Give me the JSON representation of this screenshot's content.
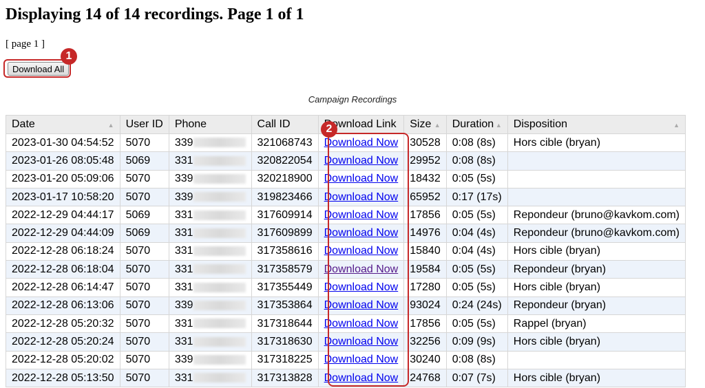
{
  "header": {
    "title": "Displaying 14 of 14 recordings. Page 1 of 1"
  },
  "pager": {
    "label": "[ page 1 ]"
  },
  "toolbar": {
    "download_all_label": "Download All"
  },
  "annotations": {
    "badge1": "1",
    "badge2": "2",
    "accent_color": "#c62828"
  },
  "table": {
    "caption": "Campaign Recordings",
    "columns": [
      "Date",
      "User ID",
      "Phone",
      "Call ID",
      "Download Link",
      "Size",
      "Duration",
      "Disposition"
    ],
    "rows": [
      {
        "date": "2023-01-30 04:54:52",
        "user_id": "5070",
        "phone": "339",
        "call_id": "321068743",
        "link": "Download Now",
        "size": "30528",
        "duration": "0:08 (8s)",
        "disposition": "Hors cible (bryan)"
      },
      {
        "date": "2023-01-26 08:05:48",
        "user_id": "5069",
        "phone": "331",
        "call_id": "320822054",
        "link": "Download Now",
        "size": "29952",
        "duration": "0:08 (8s)",
        "disposition": ""
      },
      {
        "date": "2023-01-20 05:09:06",
        "user_id": "5070",
        "phone": "339",
        "call_id": "320218900",
        "link": "Download Now",
        "size": "18432",
        "duration": "0:05 (5s)",
        "disposition": ""
      },
      {
        "date": "2023-01-17 10:58:20",
        "user_id": "5070",
        "phone": "339",
        "call_id": "319823466",
        "link": "Download Now",
        "size": "65952",
        "duration": "0:17 (17s)",
        "disposition": ""
      },
      {
        "date": "2022-12-29 04:44:17",
        "user_id": "5069",
        "phone": "331",
        "call_id": "317609914",
        "link": "Download Now",
        "size": "17856",
        "duration": "0:05 (5s)",
        "disposition": "Repondeur (bruno@kavkom.com)"
      },
      {
        "date": "2022-12-29 04:44:09",
        "user_id": "5069",
        "phone": "331",
        "call_id": "317609899",
        "link": "Download Now",
        "size": "14976",
        "duration": "0:04 (4s)",
        "disposition": "Repondeur (bruno@kavkom.com)"
      },
      {
        "date": "2022-12-28 06:18:24",
        "user_id": "5070",
        "phone": "331",
        "call_id": "317358616",
        "link": "Download Now",
        "size": "15840",
        "duration": "0:04 (4s)",
        "disposition": "Hors cible (bryan)"
      },
      {
        "date": "2022-12-28 06:18:04",
        "user_id": "5070",
        "phone": "331",
        "call_id": "317358579",
        "link": "Download Now",
        "size": "19584",
        "duration": "0:05 (5s)",
        "disposition": "Repondeur (bryan)",
        "visited": true
      },
      {
        "date": "2022-12-28 06:14:47",
        "user_id": "5070",
        "phone": "331",
        "call_id": "317355449",
        "link": "Download Now",
        "size": "17280",
        "duration": "0:05 (5s)",
        "disposition": "Hors cible (bryan)"
      },
      {
        "date": "2022-12-28 06:13:06",
        "user_id": "5070",
        "phone": "339",
        "call_id": "317353864",
        "link": "Download Now",
        "size": "93024",
        "duration": "0:24 (24s)",
        "disposition": "Repondeur (bryan)"
      },
      {
        "date": "2022-12-28 05:20:32",
        "user_id": "5070",
        "phone": "331",
        "call_id": "317318644",
        "link": "Download Now",
        "size": "17856",
        "duration": "0:05 (5s)",
        "disposition": "Rappel (bryan)"
      },
      {
        "date": "2022-12-28 05:20:24",
        "user_id": "5070",
        "phone": "331",
        "call_id": "317318630",
        "link": "Download Now",
        "size": "32256",
        "duration": "0:09 (9s)",
        "disposition": "Hors cible (bryan)"
      },
      {
        "date": "2022-12-28 05:20:02",
        "user_id": "5070",
        "phone": "339",
        "call_id": "317318225",
        "link": "Download Now",
        "size": "30240",
        "duration": "0:08 (8s)",
        "disposition": ""
      },
      {
        "date": "2022-12-28 05:13:50",
        "user_id": "5070",
        "phone": "331",
        "call_id": "317313828",
        "link": "Download Now",
        "size": "24768",
        "duration": "0:07 (7s)",
        "disposition": "Hors cible (bryan)"
      }
    ]
  }
}
